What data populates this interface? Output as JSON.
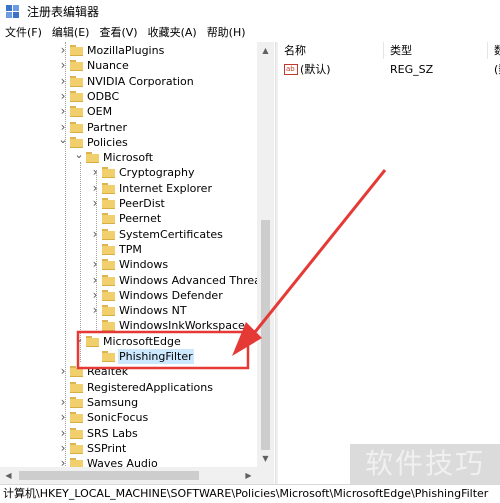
{
  "window": {
    "title": "注册表编辑器"
  },
  "menu": [
    "文件(F)",
    "编辑(E)",
    "查看(V)",
    "收藏夹(A)",
    "帮助(H)"
  ],
  "tree": [
    {
      "label": "MozillaPlugins",
      "expander": "closed",
      "depth": 1
    },
    {
      "label": "Nuance",
      "expander": "closed",
      "depth": 1
    },
    {
      "label": "NVIDIA Corporation",
      "expander": "closed",
      "depth": 1
    },
    {
      "label": "ODBC",
      "expander": "closed",
      "depth": 1
    },
    {
      "label": "OEM",
      "expander": "closed",
      "depth": 1
    },
    {
      "label": "Partner",
      "expander": "closed",
      "depth": 1
    },
    {
      "label": "Policies",
      "expander": "open",
      "depth": 1
    },
    {
      "label": "Microsoft",
      "expander": "open",
      "depth": 2
    },
    {
      "label": "Cryptography",
      "expander": "closed",
      "depth": 3
    },
    {
      "label": "Internet Explorer",
      "expander": "closed",
      "depth": 3
    },
    {
      "label": "PeerDist",
      "expander": "closed",
      "depth": 3
    },
    {
      "label": "Peernet",
      "expander": "none",
      "depth": 3
    },
    {
      "label": "SystemCertificates",
      "expander": "closed",
      "depth": 3
    },
    {
      "label": "TPM",
      "expander": "none",
      "depth": 3
    },
    {
      "label": "Windows",
      "expander": "closed",
      "depth": 3
    },
    {
      "label": "Windows Advanced Threat P",
      "expander": "closed",
      "depth": 3
    },
    {
      "label": "Windows Defender",
      "expander": "closed",
      "depth": 3
    },
    {
      "label": "Windows NT",
      "expander": "closed",
      "depth": 3
    },
    {
      "label": "WindowsInkWorkspace",
      "expander": "none",
      "depth": 3
    },
    {
      "label": "MicrosoftEdge",
      "expander": "open",
      "depth": 2
    },
    {
      "label": "PhishingFilter",
      "expander": "none",
      "depth": 3,
      "selected": true
    },
    {
      "label": "Realtek",
      "expander": "closed",
      "depth": 1
    },
    {
      "label": "RegisteredApplications",
      "expander": "none",
      "depth": 1
    },
    {
      "label": "Samsung",
      "expander": "closed",
      "depth": 1
    },
    {
      "label": "SonicFocus",
      "expander": "closed",
      "depth": 1
    },
    {
      "label": "SRS Labs",
      "expander": "closed",
      "depth": 1
    },
    {
      "label": "SSPrint",
      "expander": "closed",
      "depth": 1
    },
    {
      "label": "Waves Audio",
      "expander": "closed",
      "depth": 1
    }
  ],
  "columns": {
    "name": "名称",
    "type": "类型",
    "data": "数据"
  },
  "values": [
    {
      "icon": "string-value-icon",
      "icon_text": "ab",
      "name": "(默认)",
      "type": "REG_SZ",
      "data": "(数值未设置)"
    }
  ],
  "status": "计算机\\HKEY_LOCAL_MACHINE\\SOFTWARE\\Policies\\Microsoft\\MicrosoftEdge\\PhishingFilter",
  "watermark": "软件技巧",
  "colors": {
    "highlight": "#cce8ff",
    "annotation": "#e53935",
    "folder": "#f1cf6d"
  }
}
